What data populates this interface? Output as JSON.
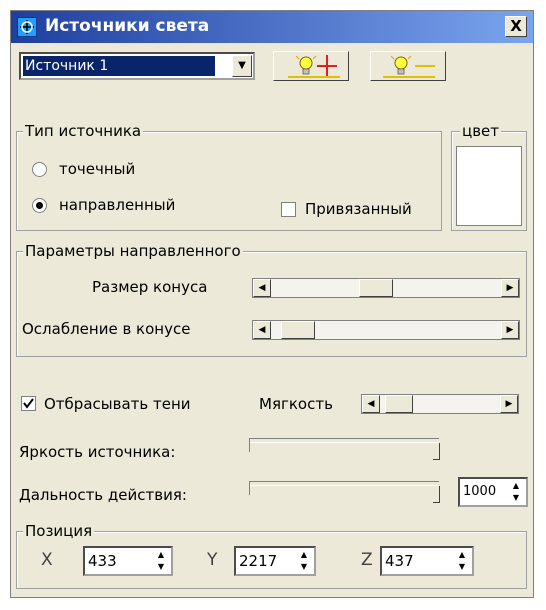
{
  "window": {
    "title": "Источники света",
    "close_label": "X"
  },
  "source_select": {
    "value": "Источник 1"
  },
  "toolbar": {
    "add_icon": "lightbulb-plus-icon",
    "remove_icon": "lightbulb-minus-icon"
  },
  "source_type": {
    "group_label": "Тип источника",
    "options": [
      {
        "label": "точечный",
        "checked": false
      },
      {
        "label": "направленный",
        "checked": true
      }
    ],
    "bound_label": "Привязанный",
    "bound_checked": false
  },
  "color": {
    "label": "цвет",
    "value": "#ffffff"
  },
  "directional": {
    "group_label": "Параметры направленного",
    "cone_size_label": "Размер конуса",
    "cone_size_level": 0.45,
    "cone_falloff_label": "Ослабление в конусе",
    "cone_falloff_level": 0.05
  },
  "shadows": {
    "label": "Отбрасывать тени",
    "checked": true,
    "softness_label": "Мягкость",
    "softness_level": 0.05
  },
  "brightness": {
    "label": "Яркость источника:",
    "level": 1.0
  },
  "range": {
    "label": "Дальность действия:",
    "level": 1.0,
    "value": "1000"
  },
  "position": {
    "group_label": "Позиция",
    "x_label": "X",
    "x_value": "433",
    "y_label": "Y",
    "y_value": "2217",
    "z_label": "Z",
    "z_value": "437"
  }
}
